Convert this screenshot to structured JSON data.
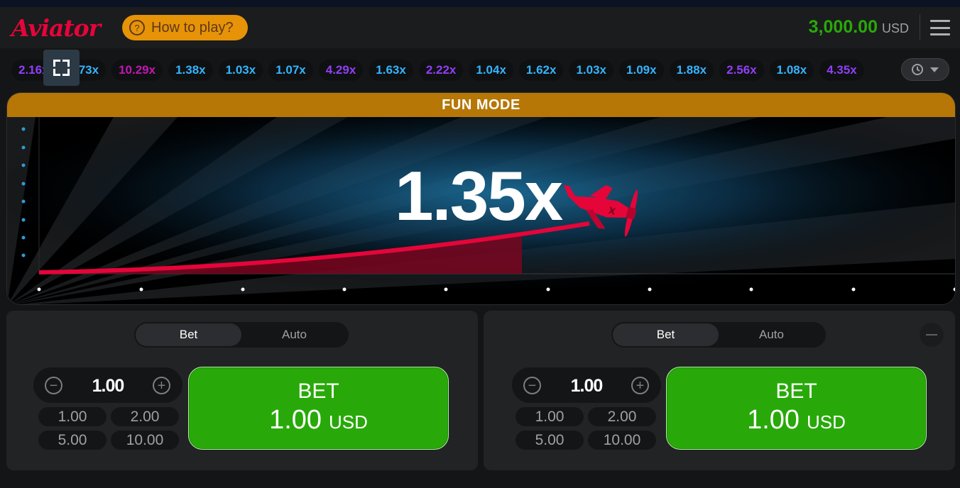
{
  "header": {
    "logo": "Aviator",
    "how_to_play": "How to play?",
    "how_to_play_icon": "question-circle-icon",
    "balance_amount": "3,000.00",
    "balance_currency": "USD",
    "menu_icon": "hamburger-menu-icon"
  },
  "payouts": [
    {
      "value": "2.16x",
      "color": "purple"
    },
    {
      "value": "1.73x",
      "color": "blue"
    },
    {
      "value": "10.29x",
      "color": "pink"
    },
    {
      "value": "1.38x",
      "color": "blue"
    },
    {
      "value": "1.03x",
      "color": "blue"
    },
    {
      "value": "1.07x",
      "color": "blue"
    },
    {
      "value": "4.29x",
      "color": "purple"
    },
    {
      "value": "1.63x",
      "color": "blue"
    },
    {
      "value": "2.22x",
      "color": "purple"
    },
    {
      "value": "1.04x",
      "color": "blue"
    },
    {
      "value": "1.62x",
      "color": "blue"
    },
    {
      "value": "1.03x",
      "color": "blue"
    },
    {
      "value": "1.09x",
      "color": "blue"
    },
    {
      "value": "1.88x",
      "color": "blue"
    },
    {
      "value": "2.56x",
      "color": "purple"
    },
    {
      "value": "1.08x",
      "color": "blue"
    },
    {
      "value": "4.35x",
      "color": "purple"
    }
  ],
  "payout_colors": {
    "blue": "#34b4ff",
    "purple": "#913ef8",
    "pink": "#c017b4"
  },
  "game": {
    "mode_banner": "FUN MODE",
    "multiplier": "1.35x",
    "accent_color": "#e50539",
    "banner_color": "#b67707"
  },
  "panels": [
    {
      "tabs": [
        "Bet",
        "Auto"
      ],
      "active_tab": "Bet",
      "stake": "1.00",
      "quick_amounts": [
        "1.00",
        "2.00",
        "5.00",
        "10.00"
      ],
      "bet_label": "BET",
      "bet_amount": "1.00",
      "bet_currency": "USD",
      "has_remove_button": false
    },
    {
      "tabs": [
        "Bet",
        "Auto"
      ],
      "active_tab": "Bet",
      "stake": "1.00",
      "quick_amounts": [
        "1.00",
        "2.00",
        "5.00",
        "10.00"
      ],
      "bet_label": "BET",
      "bet_amount": "1.00",
      "bet_currency": "USD",
      "has_remove_button": true
    }
  ],
  "bet_button_color": "#28a909"
}
